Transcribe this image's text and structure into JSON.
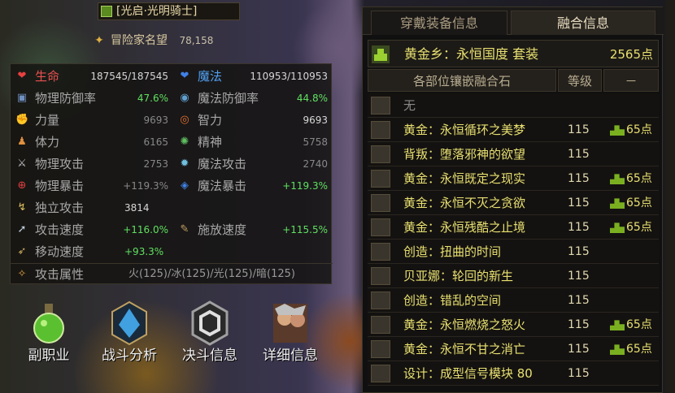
{
  "header": {
    "title": "[光启·光明骑士]",
    "fame_label": "冒险家名望",
    "fame_value": "78,158"
  },
  "stats": [
    [
      {
        "label": "生命",
        "value": "187545/187545",
        "lcolor": "red",
        "vcolor": "white",
        "icon": "heart-icon"
      },
      {
        "label": "魔法",
        "value": "110953/110953",
        "lcolor": "blue",
        "vcolor": "white",
        "icon": "mana-heart-icon"
      }
    ],
    [
      {
        "label": "物理防御率",
        "value": "47.6%",
        "lcolor": "gray",
        "vcolor": "green",
        "icon": "shield-icon"
      },
      {
        "label": "魔法防御率",
        "value": "44.8%",
        "lcolor": "gray",
        "vcolor": "green",
        "icon": "magic-shield-icon"
      }
    ],
    [
      {
        "label": "力量",
        "value": "9693",
        "lcolor": "gray",
        "vcolor": "dim",
        "icon": "strength-icon"
      },
      {
        "label": "智力",
        "value": "9693",
        "lcolor": "gray",
        "vcolor": "white",
        "icon": "intelligence-icon"
      }
    ],
    [
      {
        "label": "体力",
        "value": "6165",
        "lcolor": "gray",
        "vcolor": "dim",
        "icon": "vitality-icon"
      },
      {
        "label": "精神",
        "value": "5758",
        "lcolor": "gray",
        "vcolor": "dim",
        "icon": "spirit-icon"
      }
    ],
    [
      {
        "label": "物理攻击",
        "value": "2753",
        "lcolor": "gray",
        "vcolor": "dim",
        "icon": "sword-icon"
      },
      {
        "label": "魔法攻击",
        "value": "2740",
        "lcolor": "gray",
        "vcolor": "dim",
        "icon": "magic-attack-icon"
      }
    ],
    [
      {
        "label": "物理暴击",
        "value": "+119.3%",
        "lcolor": "gray",
        "vcolor": "dim",
        "icon": "crosshair-icon"
      },
      {
        "label": "魔法暴击",
        "value": "+119.3%",
        "lcolor": "gray",
        "vcolor": "green",
        "icon": "magic-crit-icon"
      }
    ],
    [
      {
        "label": "独立攻击",
        "value": "3814",
        "lcolor": "gray",
        "vcolor": "white",
        "icon": "independent-attack-icon"
      }
    ],
    [
      {
        "label": "攻击速度",
        "value": "+116.0%",
        "lcolor": "gray",
        "vcolor": "green",
        "icon": "attack-speed-icon"
      },
      {
        "label": "施放速度",
        "value": "+115.5%",
        "lcolor": "gray",
        "vcolor": "green",
        "icon": "cast-speed-icon"
      }
    ],
    [
      {
        "label": "移动速度",
        "value": "+93.3%",
        "lcolor": "gray",
        "vcolor": "green",
        "icon": "move-speed-icon"
      }
    ]
  ],
  "attack_attr": {
    "label": "攻击属性",
    "value": "火(125)/冰(125)/光(125)/暗(125)"
  },
  "tools": [
    {
      "label": "副职业",
      "icon": "potion-icon"
    },
    {
      "label": "战斗分析",
      "icon": "crystal-icon"
    },
    {
      "label": "决斗信息",
      "icon": "hexagon-icon"
    },
    {
      "label": "详细信息",
      "icon": "character-portrait-icon"
    }
  ],
  "right": {
    "tabs": [
      "穿戴装备信息",
      "融合信息"
    ],
    "active_tab": 1,
    "set_name": "黄金乡：永恒国度  套装",
    "set_points": "2565点",
    "headers": [
      "各部位镶嵌融合石",
      "等级",
      "－"
    ],
    "items": [
      {
        "name": "无",
        "level": "",
        "bonus": "",
        "color": "gray",
        "icon": "weapon-slot-icon"
      },
      {
        "name": "黄金：永恒循环之美梦",
        "level": "115",
        "bonus": "65点",
        "color": "gold",
        "icon": "shoulder-icon"
      },
      {
        "name": "背叛：堕落邪神的欲望",
        "level": "115",
        "bonus": "",
        "color": "gold",
        "icon": "pants-icon"
      },
      {
        "name": "黄金：永恒既定之现实",
        "level": "115",
        "bonus": "65点",
        "color": "gold",
        "icon": "belt-icon"
      },
      {
        "name": "黄金：永恒不灭之贪欲",
        "level": "115",
        "bonus": "65点",
        "color": "gold",
        "icon": "necklace-icon"
      },
      {
        "name": "黄金：永恒残酷之止境",
        "level": "115",
        "bonus": "65点",
        "color": "gold",
        "icon": "boots-icon"
      },
      {
        "name": "创造：扭曲的时间",
        "level": "115",
        "bonus": "",
        "color": "gold",
        "icon": "bracelet-icon"
      },
      {
        "name": "贝亚娜：轮回的新生",
        "level": "115",
        "bonus": "",
        "color": "gold",
        "icon": "ring-icon"
      },
      {
        "name": "创造：错乱的空间",
        "level": "115",
        "bonus": "",
        "color": "gold",
        "icon": "sub-equip-icon"
      },
      {
        "name": "黄金：永恒燃烧之怒火",
        "level": "115",
        "bonus": "65点",
        "color": "gold",
        "icon": "magic-stone-icon"
      },
      {
        "name": "黄金：永恒不甘之消亡",
        "level": "115",
        "bonus": "65点",
        "color": "gold",
        "icon": "earring-icon"
      },
      {
        "name": "设计：成型信号模块 80",
        "level": "115",
        "bonus": "",
        "color": "gold",
        "icon": "module-icon"
      }
    ]
  }
}
